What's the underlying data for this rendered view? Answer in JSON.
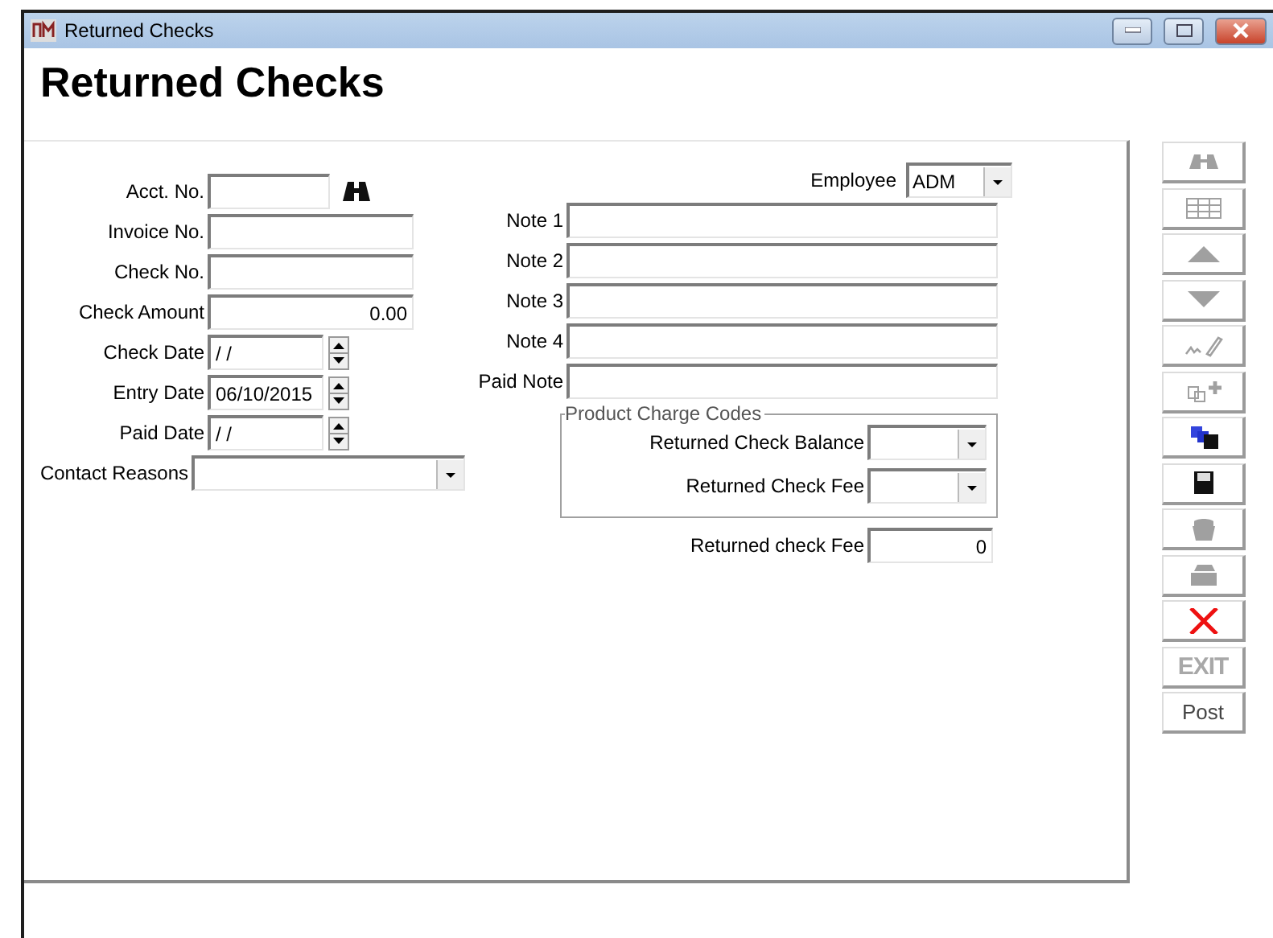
{
  "window": {
    "title": "Returned Checks"
  },
  "heading": "Returned Checks",
  "left_fields": [
    {
      "label": "Acct. No.",
      "kind": "lookup"
    },
    {
      "label": "Invoice No.",
      "kind": "text"
    },
    {
      "label": "Check No.",
      "kind": "text"
    },
    {
      "label": "Check Amount",
      "kind": "amount",
      "value": "0.00"
    },
    {
      "label": "Check Date",
      "kind": "date",
      "value": "/ /"
    },
    {
      "label": "Entry Date",
      "kind": "date",
      "value": "06/10/2015"
    },
    {
      "label": "Paid Date",
      "kind": "date",
      "value": "/ /"
    },
    {
      "label": "Contact Reasons",
      "kind": "select"
    }
  ],
  "employee": {
    "label": "Employee",
    "value": "ADM"
  },
  "notes": [
    {
      "label": "Note 1"
    },
    {
      "label": "Note 2"
    },
    {
      "label": "Note 3"
    },
    {
      "label": "Note 4"
    },
    {
      "label": "Paid Note"
    }
  ],
  "charge_codes": {
    "title": "Product Charge Codes",
    "rows": [
      {
        "label": "Returned Check Balance"
      },
      {
        "label": "Returned Check Fee"
      }
    ]
  },
  "fee": {
    "label": "Returned check Fee",
    "value": "0"
  },
  "toolbar": [
    {
      "kind": "icon",
      "disabled": true
    },
    {
      "kind": "icon",
      "disabled": true
    },
    {
      "kind": "icon",
      "disabled": true
    },
    {
      "kind": "icon",
      "disabled": true
    },
    {
      "kind": "icon",
      "disabled": true
    },
    {
      "kind": "icon",
      "disabled": true
    },
    {
      "kind": "icon",
      "disabled": false
    },
    {
      "kind": "icon",
      "disabled": false
    },
    {
      "kind": "icon",
      "disabled": true
    },
    {
      "kind": "icon",
      "disabled": true
    },
    {
      "kind": "icon",
      "disabled": false
    },
    {
      "kind": "text",
      "label": "EXIT",
      "disabled": true
    },
    {
      "kind": "text",
      "label": "Post",
      "disabled": false
    }
  ]
}
